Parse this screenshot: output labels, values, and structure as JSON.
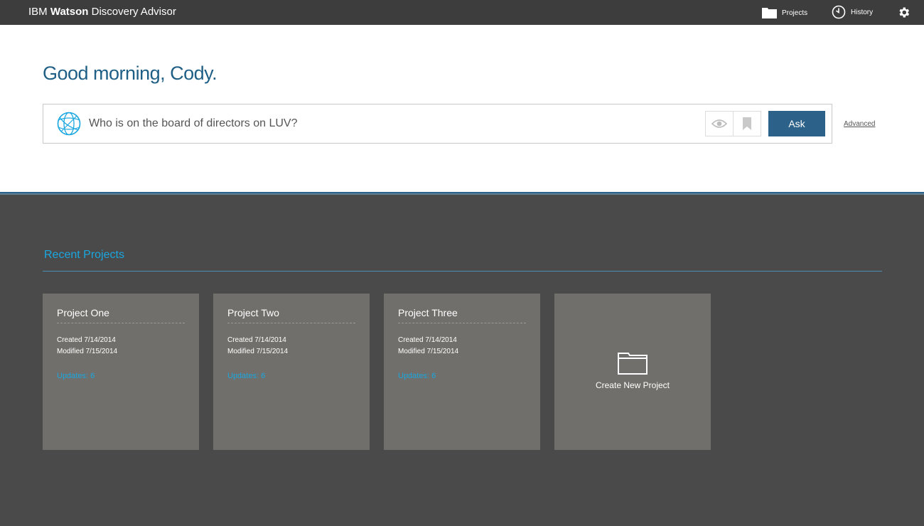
{
  "header": {
    "brand_prefix": "IBM",
    "brand_bold": "Watson",
    "brand_suffix": "Discovery Advisor",
    "nav_projects": "Projects",
    "nav_history": "History",
    "icons": {
      "projects": "folder-icon",
      "history": "clock-icon",
      "settings": "gear-icon"
    }
  },
  "greeting": "Good morning, Cody.",
  "search": {
    "query": "Who is on the board of directors on LUV?",
    "ask_label": "Ask",
    "advanced_label": "Advanced",
    "icons": {
      "globe": "globe-icon",
      "watch": "eye-icon",
      "save": "bookmark-icon"
    }
  },
  "recent": {
    "title": "Recent Projects",
    "projects": [
      {
        "name": "Project One",
        "created": "Created 7/14/2014",
        "modified": "Modified 7/15/2014",
        "updates": "Updates: 6"
      },
      {
        "name": "Project Two",
        "created": "Created 7/14/2014",
        "modified": "Modified 7/15/2014",
        "updates": "Updates: 6"
      },
      {
        "name": "Project Three",
        "created": "Created 7/14/2014",
        "modified": "Modified 7/15/2014",
        "updates": "Updates: 6"
      }
    ],
    "create_label": "Create New Project"
  },
  "colors": {
    "topbar": "#3d3d3d",
    "accent_blue": "#2c6189",
    "link_blue": "#1aa7e0",
    "dark_bg": "#4a4a4a",
    "card_bg": "#706f6b"
  }
}
